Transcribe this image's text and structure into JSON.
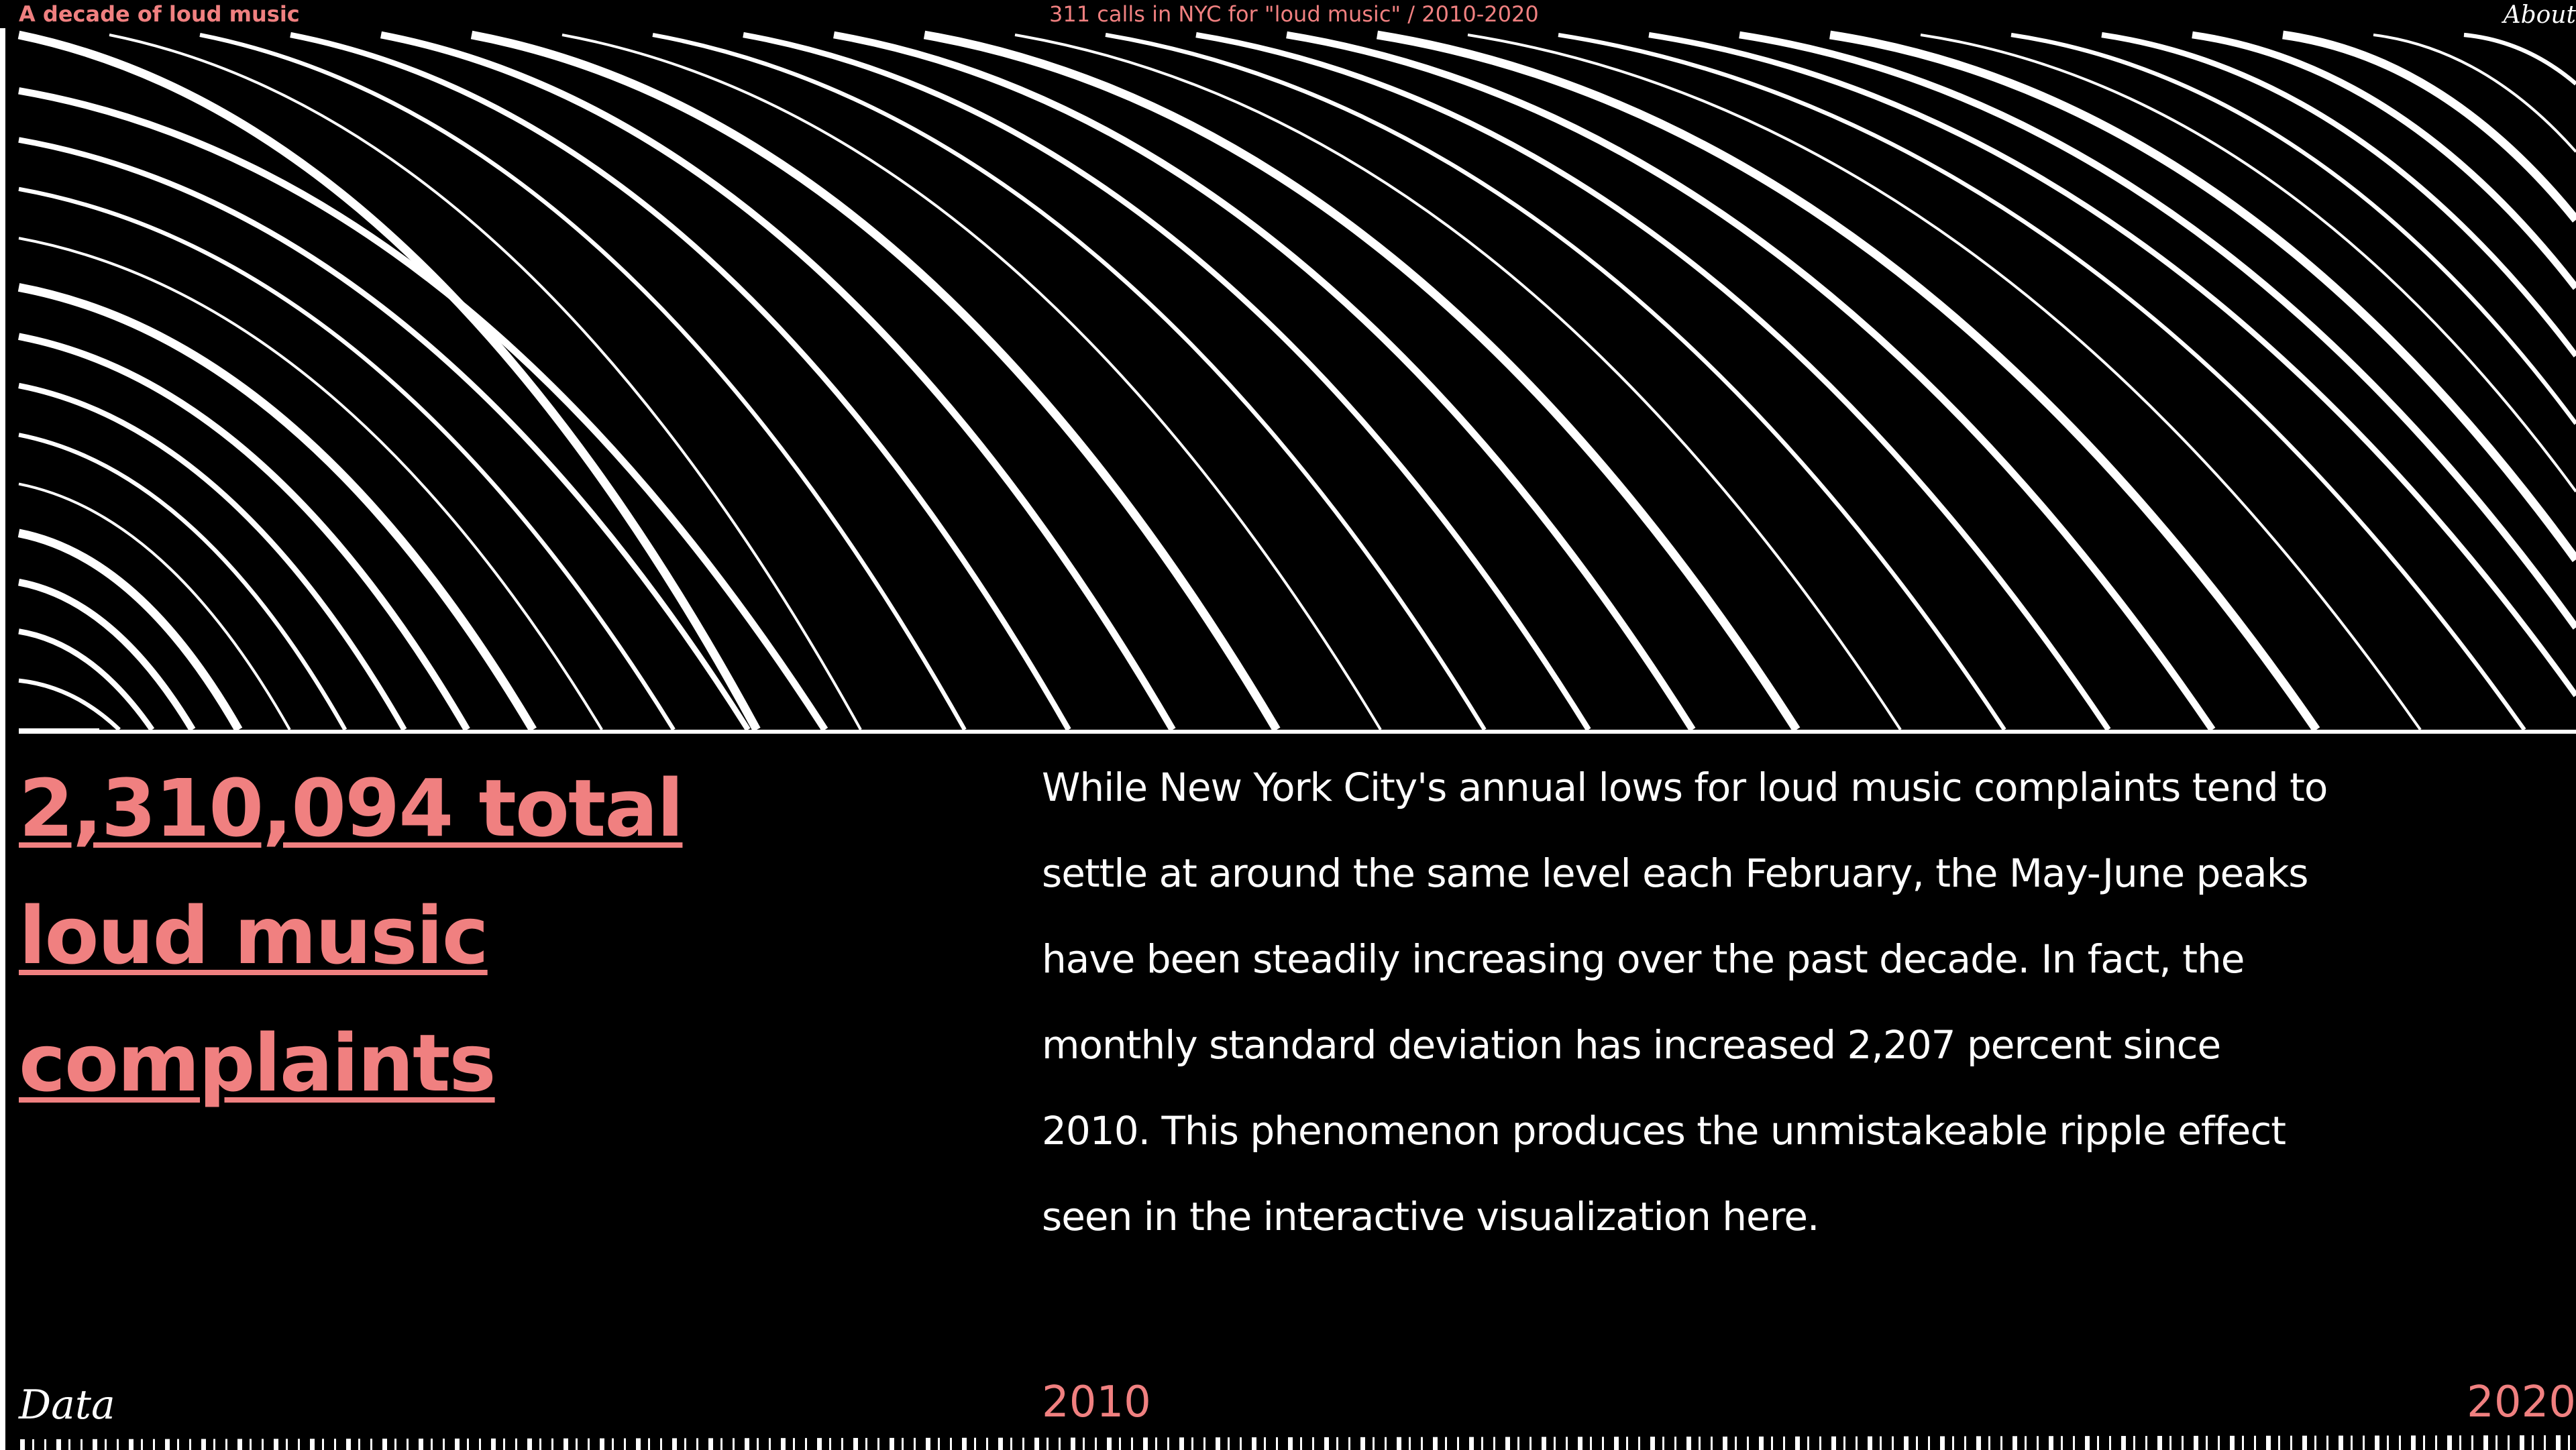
{
  "header": {
    "site_title": "A decade of loud music",
    "subtitle": "311 calls in NYC for \"loud music\" / 2010-2020",
    "about_label": "About"
  },
  "main": {
    "headline": "2,310,094 total loud music complaints",
    "paragraph": "While New York City's annual lows for loud music complaints tend to settle at around the same level each February, the May-June peaks have been steadily increasing over the past decade. In fact, the monthly standard deviation has increased 2,207 percent since 2010. This phenomenon produces the unmistakeable ripple effect seen in the interactive visualization here."
  },
  "footer": {
    "data_label": "Data",
    "year_start": "2010",
    "year_end": "2020"
  },
  "colors": {
    "background": "#000000",
    "accent": "#f08080",
    "line": "#ffffff"
  }
}
